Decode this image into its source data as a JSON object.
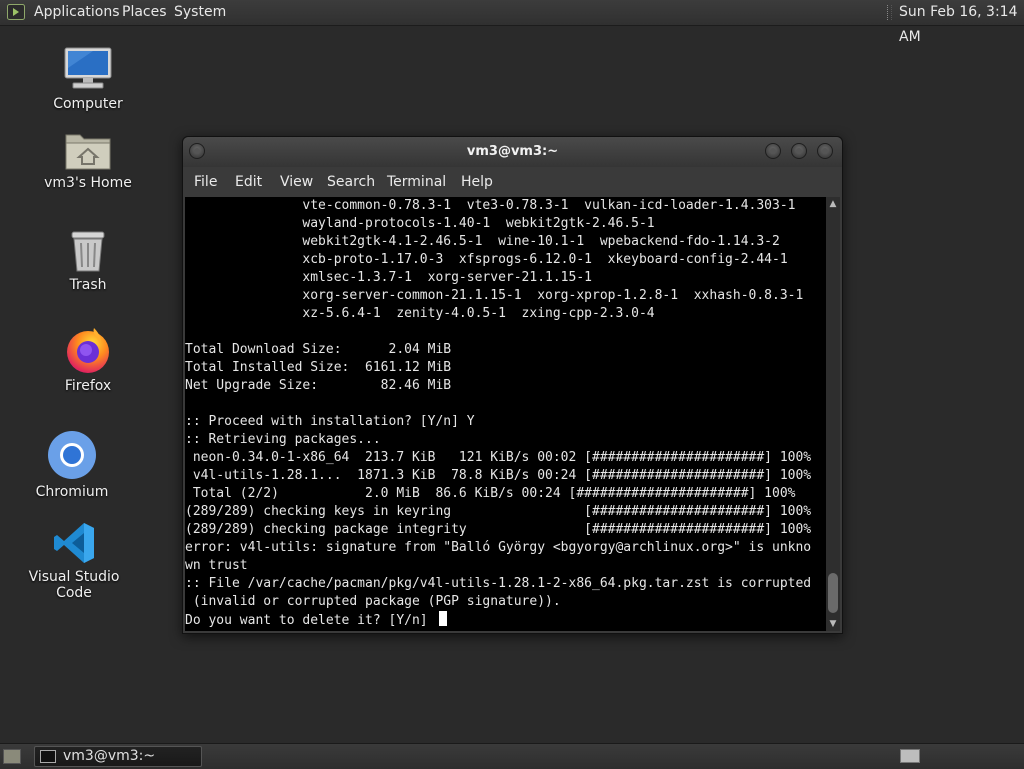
{
  "top_panel": {
    "menus": [
      "Applications",
      "Places",
      "System"
    ],
    "clock": "Sun Feb 16,  3:14 AM"
  },
  "desktop_icons": [
    {
      "label": "Computer",
      "icon": "computer-icon"
    },
    {
      "label": "vm3's Home",
      "icon": "home-folder-icon"
    },
    {
      "label": "Trash",
      "icon": "trash-icon"
    },
    {
      "label": "Firefox",
      "icon": "firefox-icon"
    },
    {
      "label": "Chromium",
      "icon": "chromium-icon"
    },
    {
      "label": "Visual Studio Code",
      "icon": "vscode-icon"
    }
  ],
  "terminal": {
    "title": "vm3@vm3:~",
    "menu": [
      "File",
      "Edit",
      "View",
      "Search",
      "Terminal",
      "Help"
    ],
    "lines": [
      "               vte-common-0.78.3-1  vte3-0.78.3-1  vulkan-icd-loader-1.4.303-1",
      "               wayland-protocols-1.40-1  webkit2gtk-2.46.5-1",
      "               webkit2gtk-4.1-2.46.5-1  wine-10.1-1  wpebackend-fdo-1.14.3-2",
      "               xcb-proto-1.17.0-3  xfsprogs-6.12.0-1  xkeyboard-config-2.44-1",
      "               xmlsec-1.3.7-1  xorg-server-21.1.15-1",
      "               xorg-server-common-21.1.15-1  xorg-xprop-1.2.8-1  xxhash-0.8.3-1",
      "               xz-5.6.4-1  zenity-4.0.5-1  zxing-cpp-2.3.0-4",
      "",
      "Total Download Size:      2.04 MiB",
      "Total Installed Size:  6161.12 MiB",
      "Net Upgrade Size:        82.46 MiB",
      "",
      ":: Proceed with installation? [Y/n] Y",
      ":: Retrieving packages...",
      " neon-0.34.0-1-x86_64  213.7 KiB   121 KiB/s 00:02 [######################] 100%",
      " v4l-utils-1.28.1...  1871.3 KiB  78.8 KiB/s 00:24 [######################] 100%",
      " Total (2/2)           2.0 MiB  86.6 KiB/s 00:24 [######################] 100%",
      "(289/289) checking keys in keyring                 [######################] 100%",
      "(289/289) checking package integrity               [######################] 100%",
      "error: v4l-utils: signature from \"Balló György <bgyorgy@archlinux.org>\" is unkno",
      "wn trust",
      ":: File /var/cache/pacman/pkg/v4l-utils-1.28.1-2-x86_64.pkg.tar.zst is corrupted",
      " (invalid or corrupted package (PGP signature)).",
      "Do you want to delete it? [Y/n] "
    ]
  },
  "taskbar": {
    "window_button": "vm3@vm3:~"
  }
}
